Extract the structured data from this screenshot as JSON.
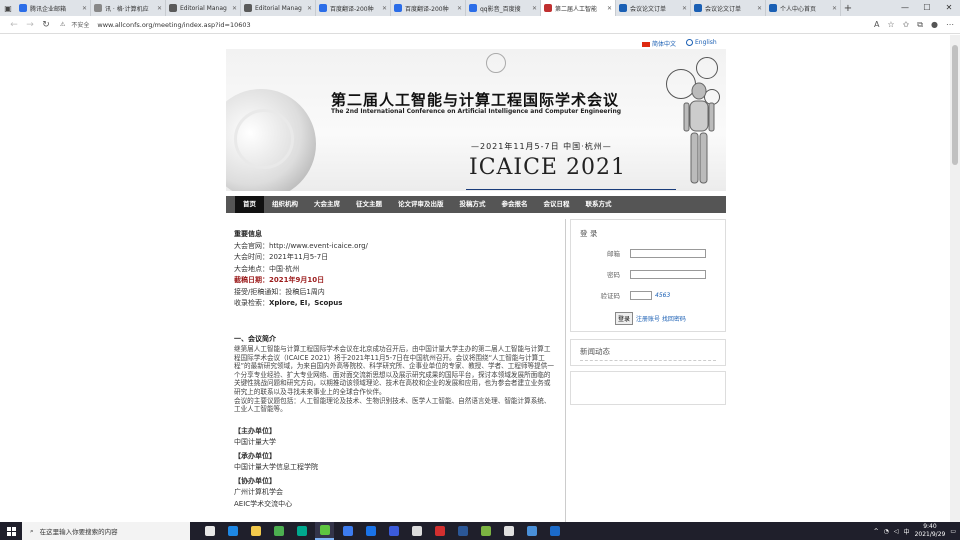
{
  "browser": {
    "tabs": [
      {
        "label": "腾讯企业邮箱",
        "color": "#2b6de8",
        "active": false
      },
      {
        "label": "讯 · 格·计算机应",
        "color": "#888888",
        "active": false
      },
      {
        "label": "Editorial Manag",
        "color": "#5a5a5a",
        "active": false
      },
      {
        "label": "Editorial Manag",
        "color": "#5a5a5a",
        "active": false
      },
      {
        "label": "百度翻译-200种",
        "color": "#2b6de8",
        "active": false
      },
      {
        "label": "百度翻译-200种",
        "color": "#2b6de8",
        "active": false
      },
      {
        "label": "qq影音_百度搜",
        "color": "#2b6de8",
        "active": false
      },
      {
        "label": "第二届人工智能",
        "color": "#c03030",
        "active": true
      },
      {
        "label": "会议论文订单",
        "color": "#1a5fb4",
        "active": false
      },
      {
        "label": "会议论文订单",
        "color": "#1a5fb4",
        "active": false
      },
      {
        "label": "个人中心首页",
        "color": "#1a5fb4",
        "active": false
      }
    ],
    "new_tab": "+",
    "secure_label": "不安全",
    "url": "www.allconfs.org/meeting/index.asp?id=10603"
  },
  "page": {
    "lang_cn": "简体中文",
    "lang_en": "English",
    "banner": {
      "title_cn": "第二届人工智能与计算工程国际学术会议",
      "title_en": "The 2nd International Conference on Artificial Intelligence and Computer Engineering",
      "date": "—2021年11月5-7日   中国·杭州—",
      "brand": "ICAICE 2021"
    },
    "nav": [
      "首页",
      "组织机构",
      "大会主席",
      "征文主题",
      "论文评审及出版",
      "投稿方式",
      "参会报名",
      "会议日程",
      "联系方式"
    ],
    "info": {
      "heading": "重要信息",
      "website": "大会官网：http://www.event-icaice.org/",
      "time": "大会时间：2021年11月5-7日",
      "place": "大会地点：中国·杭州",
      "deadline_label": "截稿日期：",
      "deadline_value": "2021年9月10日",
      "notice": "接受/拒稿通知：投稿后1周内",
      "index_label": "收录检索：",
      "index_value": "Xplore, EI，Scopus"
    },
    "intro": {
      "heading": "一、会议简介",
      "para1": "继第届人工智能与计算工程国际学术会议在北京成功召开后，由中国计量大学主办的第二届人工智能与计算工程国际学术会议（ICAICE 2021）将于2021年11月5-7日在中国杭州召开。会议将围绕“人工智能与计算工程”的最新研究领域，为来自国内外高等院校、科学研究所、企事业单位的专家、教授、学者、工程师等提供一个分享专业经验、扩大专业网络、面对面交流新思想以及展示研究成果的国际平台，探讨本领域发展所面临的关键性挑战问题和研究方向，以期推动该领域理论、技术在高校和企业的发展和应用，也为参会者建立业务或研究上的联系以及寻找未来事业上的全球合作伙伴。",
      "para2": "会议的主要议题包括：人工智能理论及技术、生物识别技术、医学人工智能、自然语言处理、智能计算系统、工业人工智能等。"
    },
    "units": [
      {
        "title": "【主办单位】",
        "value": "中国计量大学"
      },
      {
        "title": "【承办单位】",
        "value": "中国计量大学信息工程学院"
      },
      {
        "title": "【协办单位】",
        "value": "广州计算机学会"
      },
      {
        "title": "",
        "value": "AEIC学术交流中心"
      }
    ],
    "login": {
      "title": "登 录",
      "email_label": "邮箱",
      "password_label": "密码",
      "captcha_label": "验证码",
      "captcha_code": "4563",
      "submit": "登录",
      "links": "注册账号 找回密码"
    },
    "news": {
      "title": "新闻动态"
    }
  },
  "taskbar": {
    "search_placeholder": "在这里输入你要搜索的内容",
    "apps": [
      "#e8e8e8",
      "#1e88e5",
      "#f2c94c",
      "#4caf50",
      "#00a98f",
      "#5ec541",
      "#3d7cf0",
      "#1a73e8",
      "#3b5bdb",
      "#dddddd",
      "#d32f2f",
      "#2b5797",
      "#7cb342",
      "#e0e0e0",
      "#4a90d9",
      "#1b6ac9"
    ],
    "ime": "中",
    "time": "9:40",
    "date": "2021/9/29"
  }
}
